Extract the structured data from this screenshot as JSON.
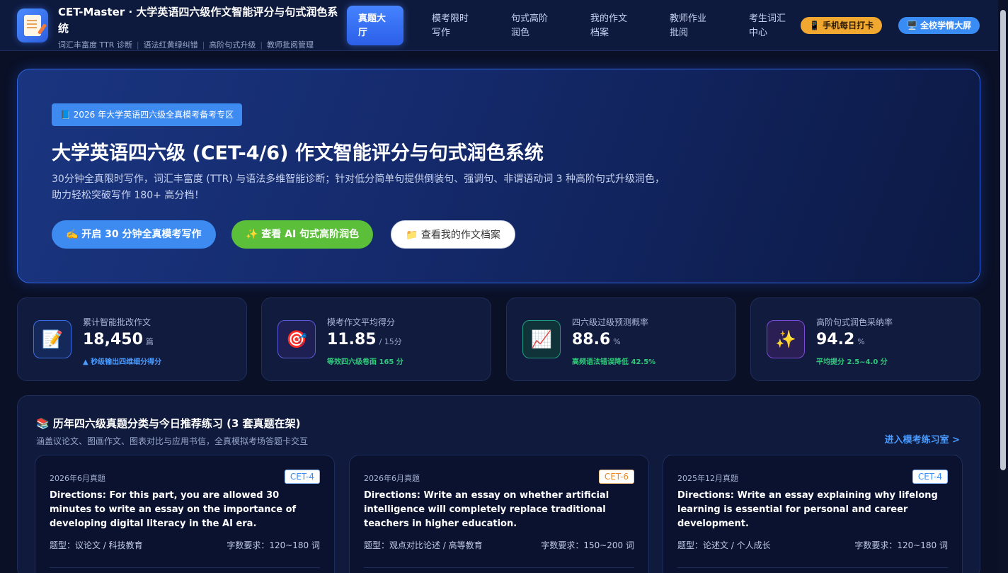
{
  "header": {
    "title": "CET-Master · 大学英语四六级作文智能评分与句式润色系统",
    "subtitle_items": [
      "词汇丰富度 TTR 诊断",
      "语法红黄绿纠错",
      "高阶句式升级",
      "教师批阅管理"
    ],
    "nav": [
      {
        "label": "真题大厅",
        "active": true
      },
      {
        "label": "模考限时写作",
        "active": false
      },
      {
        "label": "句式高阶润色",
        "active": false
      },
      {
        "label": "我的作文档案",
        "active": false
      },
      {
        "label": "教师作业批阅",
        "active": false
      },
      {
        "label": "考生词汇中心",
        "active": false
      }
    ],
    "checkin_label": "📱 手机每日打卡",
    "screen_label": "🖥️ 全校学情大屏"
  },
  "hero": {
    "tag": "📘 2026 年大学英语四六级全真模考备考专区",
    "title": "大学英语四六级 (CET-4/6) 作文智能评分与句式润色系统",
    "desc": "30分钟全真限时写作，词汇丰富度 (TTR) 与语法多维智能诊断；针对低分简单句提供倒装句、强调句、非谓语动词 3 种高阶句式升级润色，助力轻松突破写作 180+ 高分档！",
    "btn_start": "✍️ 开启 30 分钟全真模考写作",
    "btn_polish": "✨ 查看 AI 句式高阶润色",
    "btn_archive": "📁 查看我的作文档案"
  },
  "stats": [
    {
      "icon": "📝",
      "label": "累计智能批改作文",
      "value": "18,450",
      "unit": "篇",
      "note": "▲ 秒级输出四维细分得分",
      "note_color": "#4a9bff",
      "icon_bg": "#15285a",
      "icon_border": "#3a6ee8"
    },
    {
      "icon": "🎯",
      "label": "模考作文平均得分",
      "value": "11.85",
      "unit": "/ 15分",
      "note": "等效四六级卷面 165 分",
      "note_color": "#2fc97a",
      "icon_bg": "#1e1f52",
      "icon_border": "#5a5ad8"
    },
    {
      "icon": "📈",
      "label": "四六级过级预测概率",
      "value": "88.6",
      "unit": "%",
      "note": "高频语法错误降低 42.5%",
      "note_color": "#2fc97a",
      "icon_bg": "#0f3338",
      "icon_border": "#1f9c80"
    },
    {
      "icon": "✨",
      "label": "高阶句式润色采纳率",
      "value": "94.2",
      "unit": "%",
      "note": "平均提分 2.5~4.0 分",
      "note_color": "#2fc97a",
      "icon_bg": "#2a1f55",
      "icon_border": "#7a4ad8"
    }
  ],
  "section": {
    "title": "📚 历年四六级真题分类与今日推荐练习 (3 套真题在架)",
    "subtitle": "涵盖议论文、图画作文、图表对比与应用书信，全真模拟考场答题卡交互",
    "link": "进入模考练习室 >"
  },
  "cards": [
    {
      "date": "2026年6月真题",
      "badge": "CET-4",
      "text": "Directions: For this part, you are allowed 30 minutes to write an essay on the importance of developing digital literacy in the AI era.",
      "type": "题型：议论文 / 科技教育",
      "words": "字数要求：120~180 词"
    },
    {
      "date": "2026年6月真题",
      "badge": "CET-6",
      "text": "Directions: Write an essay on whether artificial intelligence will completely replace traditional teachers in higher education.",
      "type": "题型：观点对比论述 / 高等教育",
      "words": "字数要求：150~200 词"
    },
    {
      "date": "2025年12月真题",
      "badge": "CET-4",
      "text": "Directions: Write an essay explaining why lifelong learning is essential for personal and career development.",
      "type": "题型：论述文 / 个人成长",
      "words": "字数要求：120~180 词"
    }
  ]
}
